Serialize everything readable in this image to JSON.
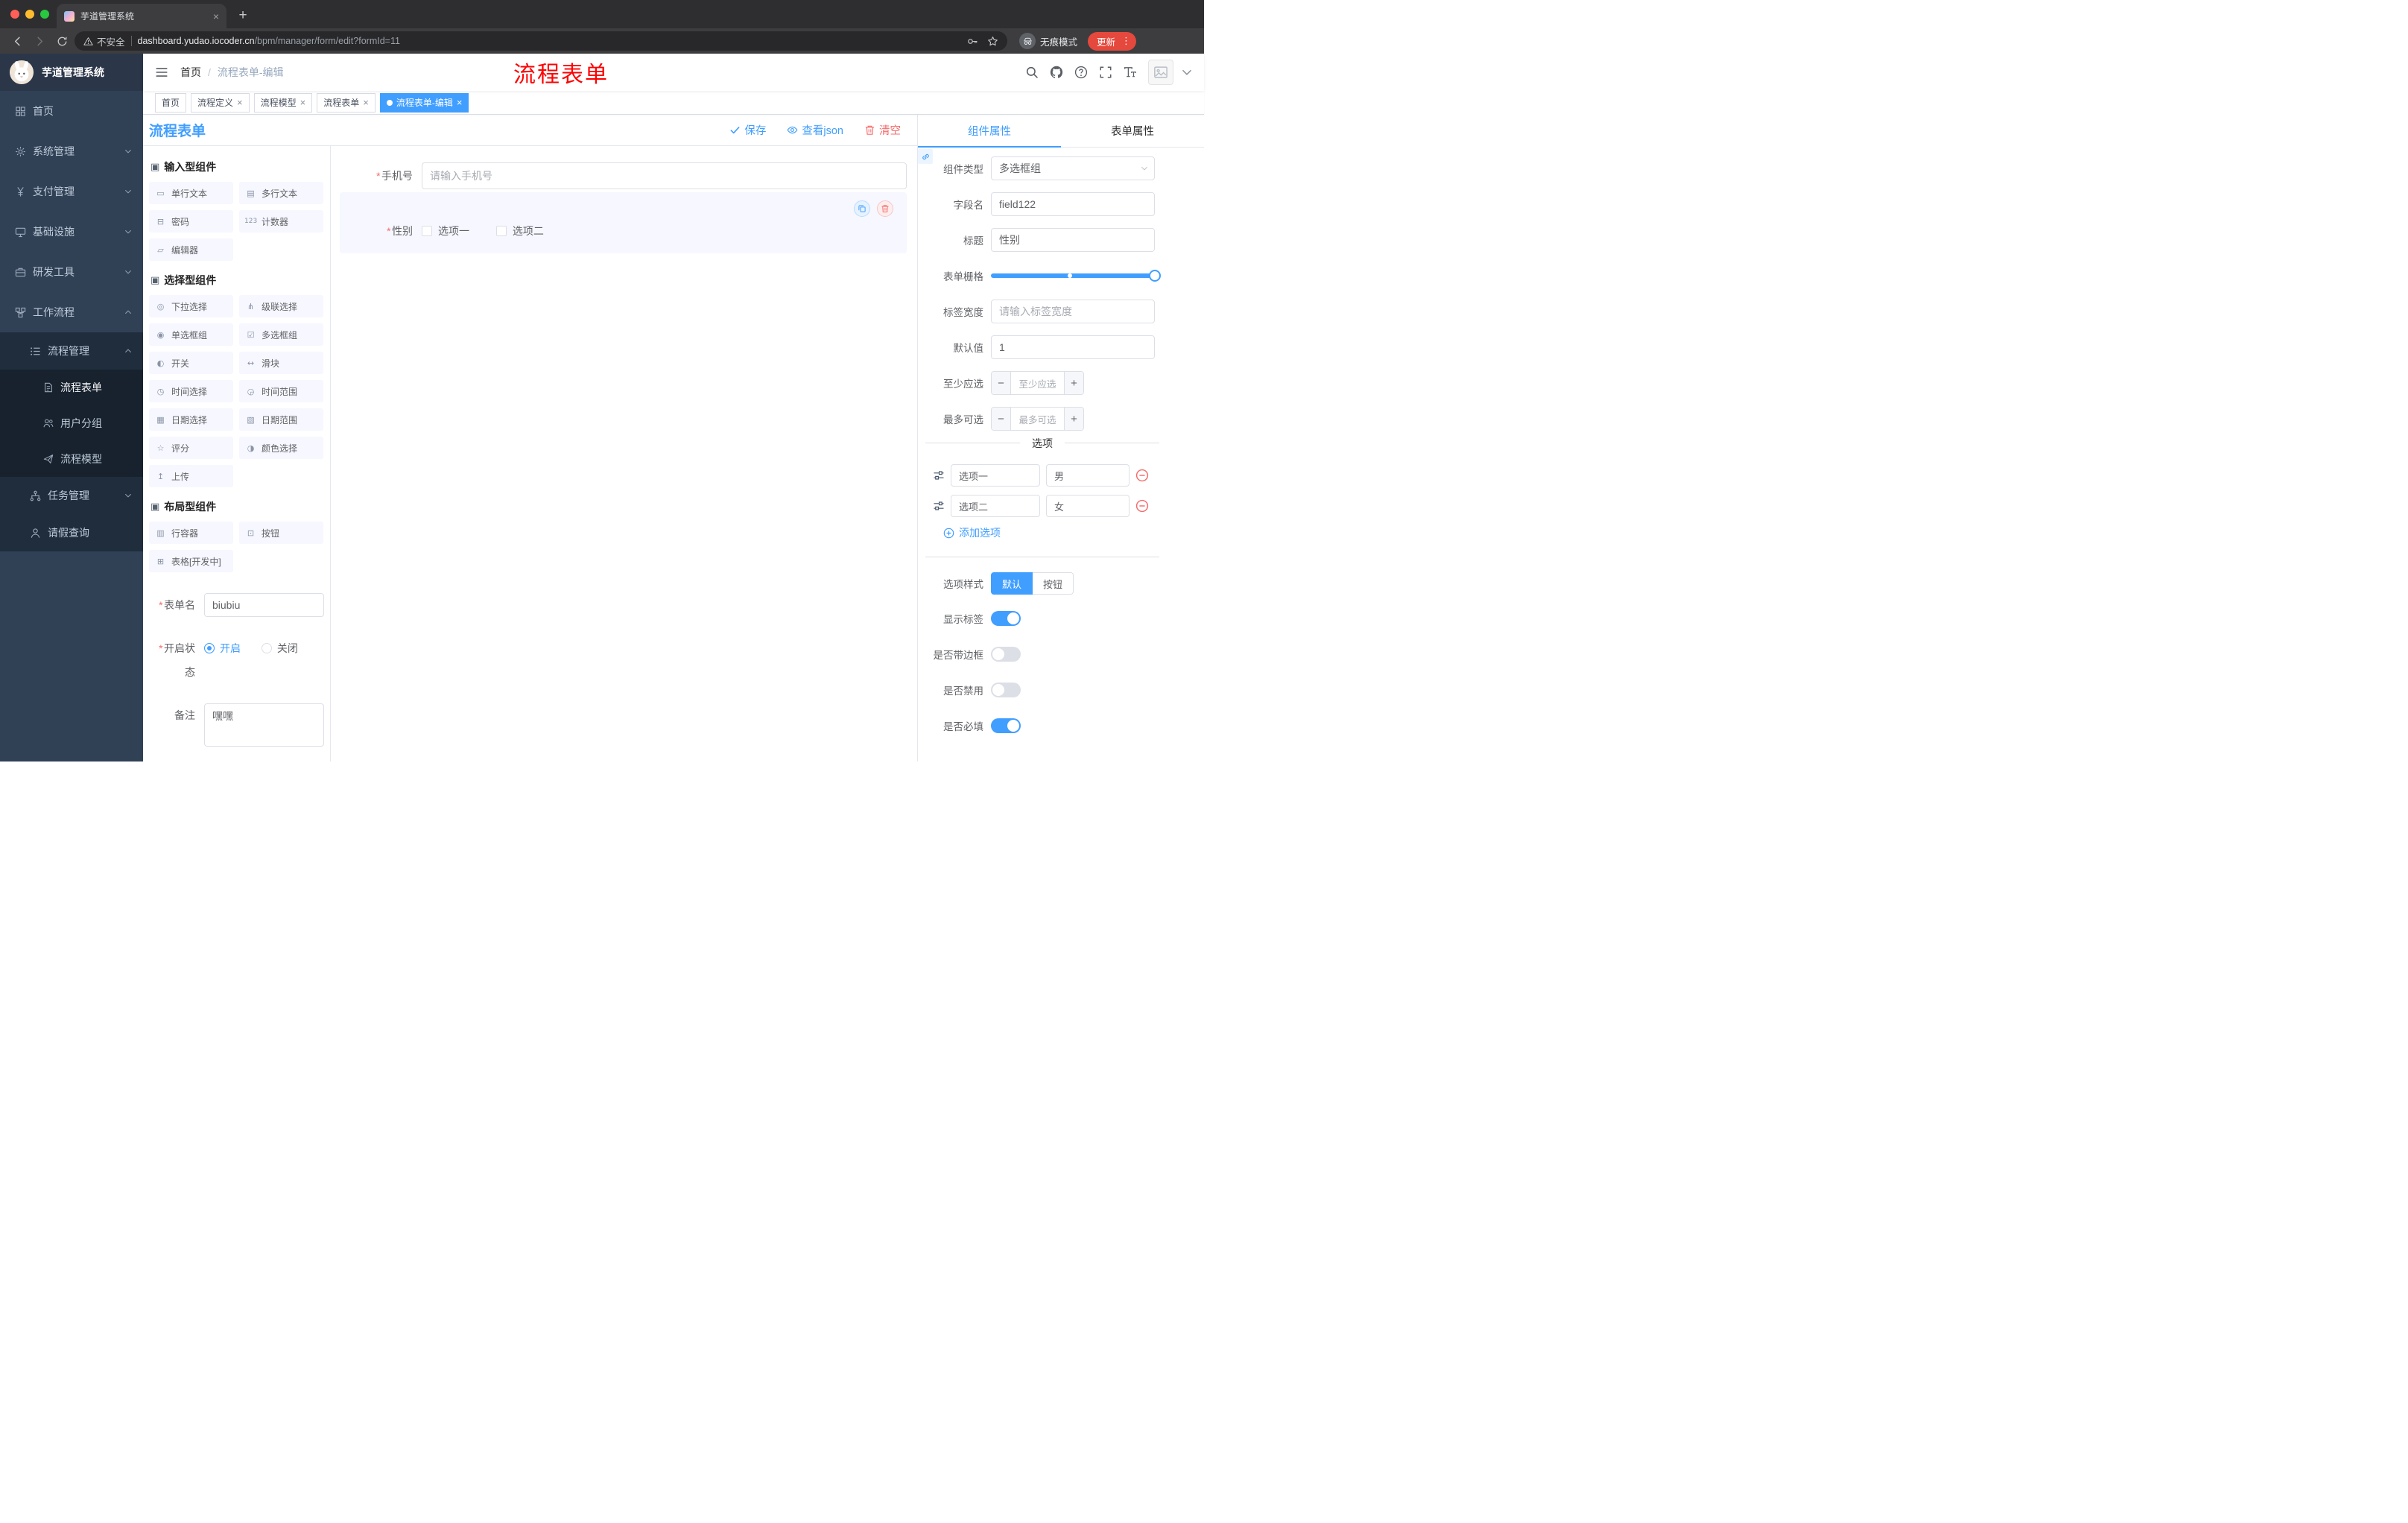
{
  "ui": {
    "close": "×",
    "plus": "+",
    "dots": "⋮",
    "asterisk": "*"
  },
  "colors": {
    "primary": "#409eff",
    "danger": "#f56c6c",
    "annotation": "#ff0000"
  },
  "browser": {
    "tab_title": "芋道管理系统",
    "security_label": "不安全",
    "url_domain": "dashboard.yudao.iocoder.cn",
    "url_path": "/bpm/manager/form/edit?formId=11",
    "incognito_label": "无痕模式",
    "update_label": "更新"
  },
  "sidebar": {
    "logo_title": "芋道管理系统",
    "items": [
      {
        "label": "首页"
      },
      {
        "label": "系统管理"
      },
      {
        "label": "支付管理"
      },
      {
        "label": "基础设施"
      },
      {
        "label": "研发工具"
      },
      {
        "label": "工作流程"
      },
      {
        "label": "流程管理"
      },
      {
        "label": "流程表单"
      },
      {
        "label": "用户分组"
      },
      {
        "label": "流程模型"
      },
      {
        "label": "任务管理"
      },
      {
        "label": "请假查询"
      }
    ]
  },
  "header": {
    "breadcrumb_home": "首页",
    "breadcrumb_sep": "/",
    "breadcrumb_current": "流程表单-编辑",
    "annotation": "流程表单"
  },
  "tags": [
    {
      "label": "首页"
    },
    {
      "label": "流程定义"
    },
    {
      "label": "流程模型"
    },
    {
      "label": "流程表单"
    },
    {
      "label": "流程表单-编辑"
    }
  ],
  "editor": {
    "title": "流程表单",
    "save": "保存",
    "view_json": "查看json",
    "clear": "清空"
  },
  "panel": {
    "groups": [
      {
        "title": "输入型组件",
        "items": [
          {
            "label": "单行文本",
            "icon": "▭"
          },
          {
            "label": "多行文本",
            "icon": "▤"
          },
          {
            "label": "密码",
            "icon": "⊟"
          },
          {
            "label": "计数器",
            "icon": "123"
          },
          {
            "label": "编辑器",
            "icon": "▱"
          }
        ]
      },
      {
        "title": "选择型组件",
        "items": [
          {
            "label": "下拉选择",
            "icon": "◎"
          },
          {
            "label": "级联选择",
            "icon": "⋔"
          },
          {
            "label": "单选框组",
            "icon": "◉"
          },
          {
            "label": "多选框组",
            "icon": "☑"
          },
          {
            "label": "开关",
            "icon": "◐"
          },
          {
            "label": "滑块",
            "icon": "↔"
          },
          {
            "label": "时间选择",
            "icon": "◷"
          },
          {
            "label": "时间范围",
            "icon": "◶"
          },
          {
            "label": "日期选择",
            "icon": "▦"
          },
          {
            "label": "日期范围",
            "icon": "▧"
          },
          {
            "label": "评分",
            "icon": "☆"
          },
          {
            "label": "颜色选择",
            "icon": "◑"
          },
          {
            "label": "上传",
            "icon": "↥"
          }
        ]
      },
      {
        "title": "布局型组件",
        "items": [
          {
            "label": "行容器",
            "icon": "▥"
          },
          {
            "label": "按钮",
            "icon": "⊡"
          },
          {
            "label": "表格[开发中]",
            "icon": "⊞"
          }
        ]
      }
    ],
    "form": {
      "name_label": "表单名",
      "name_value": "biubiu",
      "status_label": "开启状态",
      "status_on": "开启",
      "status_off": "关闭",
      "remark_label": "备注",
      "remark_value": "嘿嘿"
    }
  },
  "canvas": {
    "phone_label": "手机号",
    "phone_placeholder": "请输入手机号",
    "gender_label": "性别",
    "gender_options": [
      "选项一",
      "选项二"
    ]
  },
  "props": {
    "tabs": [
      "组件属性",
      "表单属性"
    ],
    "type_label": "组件类型",
    "type_value": "多选框组",
    "field_label": "字段名",
    "field_value": "field122",
    "title_label": "标题",
    "title_value": "性别",
    "grid_label": "表单栅格",
    "label_width_label": "标签宽度",
    "label_width_placeholder": "请输入标签宽度",
    "default_label": "默认值",
    "default_value": "1",
    "min_label": "至少应选",
    "min_placeholder": "至少应选",
    "max_label": "最多可选",
    "max_placeholder": "最多可选",
    "options_title": "选项",
    "options": [
      {
        "label": "选项一",
        "value": "男"
      },
      {
        "label": "选项二",
        "value": "女"
      }
    ],
    "add_option": "添加选项",
    "style_label": "选项样式",
    "style_options": [
      "默认",
      "按钮"
    ],
    "style_active": "默认",
    "switches": [
      {
        "label": "显示标签",
        "on": true
      },
      {
        "label": "是否带边框",
        "on": false
      },
      {
        "label": "是否禁用",
        "on": false
      },
      {
        "label": "是否必填",
        "on": true
      }
    ]
  }
}
